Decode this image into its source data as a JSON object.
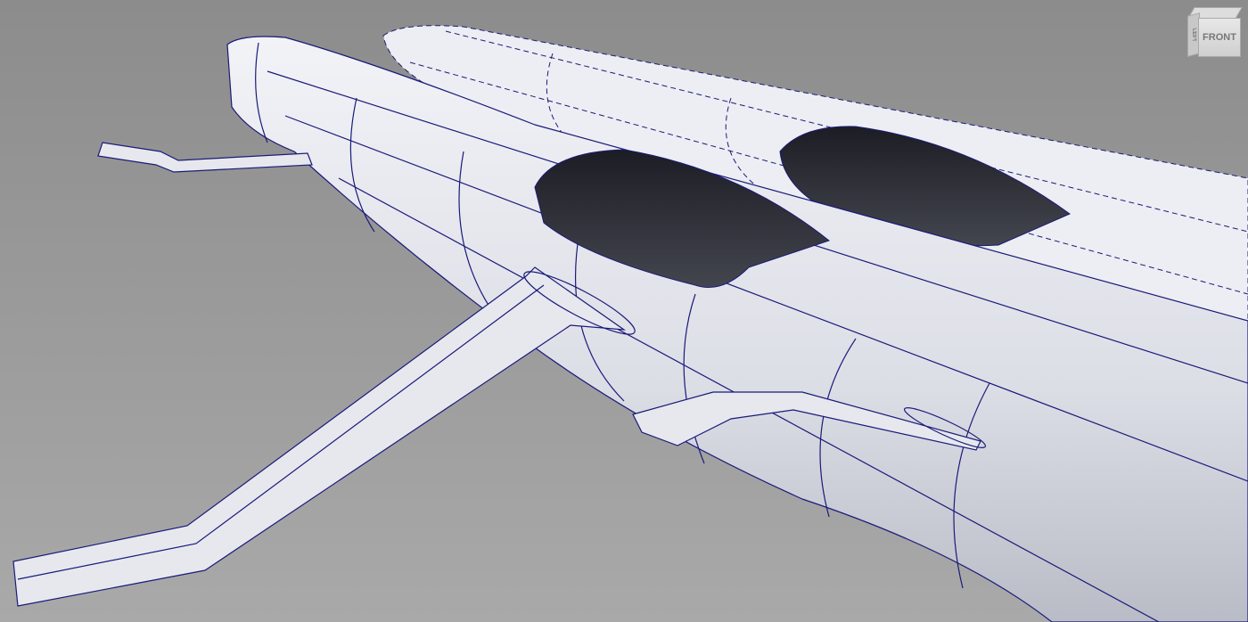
{
  "viewport": {
    "view_cube": {
      "front_label": "FRONT",
      "left_label": "LEFT"
    },
    "colors": {
      "background": "#9a9a9a",
      "surface": "#e6e8ee",
      "wire": "#1a1a7a",
      "canopy": "#2a2b33",
      "edge_green": "#3a7a3a"
    }
  }
}
